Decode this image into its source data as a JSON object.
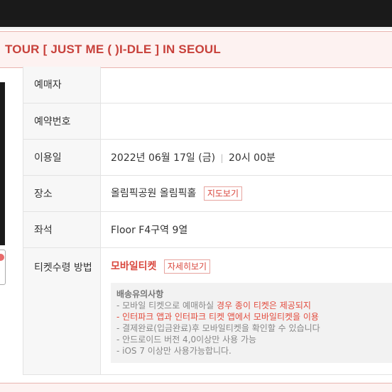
{
  "title": "TOUR  [ JUST ME ( )I-DLE ]  IN SEOUL",
  "rows": [
    {
      "label": "예매자",
      "value": ""
    },
    {
      "label": "예약번호",
      "value": ""
    },
    {
      "label": "이용일",
      "date": "2022년 06월 17일 (금)",
      "separator": "|",
      "time": "20시 00분"
    },
    {
      "label": "장소",
      "value": "올림픽공원 올림픽홀",
      "button": "지도보기"
    },
    {
      "label": "좌석",
      "value": "Floor F4구역 9열"
    },
    {
      "label": "티켓수령 방법",
      "value": "모바일티켓",
      "button": "자세히보기"
    }
  ],
  "notice": {
    "title": "배송유의사항",
    "line1_prefix": "- 모바일 티켓으로 예매하실 ",
    "line1_highlight": "경우 종이 티켓은 제공되지",
    "line2": "- 인터파크 앱과 인터파크 티켓 앱에서 모바일티켓을 이용",
    "line3": "- 결제완료(입금완료)후 모바일티켓을 확인할 수 있습니다",
    "line4": "- 안드로이드 버전 4,0이상만 사용 가능",
    "line5": "- iOS 7 이상만 사용가능합니다."
  },
  "colors": {
    "accent": "#d9463c",
    "header_bg": "#fdf2f1",
    "label_bg": "#f7f7f7"
  }
}
